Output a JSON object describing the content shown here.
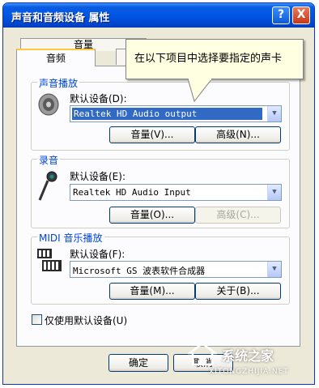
{
  "window": {
    "title": "声音和音频设备 属性",
    "help_glyph": "?",
    "close_glyph": "X"
  },
  "tabs": [
    {
      "label": "音量",
      "active": false
    },
    {
      "label": "音频",
      "active": true
    }
  ],
  "tooltip": "在以下项目中选择要指定的声卡",
  "sections": {
    "playback": {
      "title": "声音播放",
      "icon": "speaker-icon",
      "device_label": "默认设备(D):",
      "device_value": "Realtek HD Audio output",
      "volume_button": "音量(V)...",
      "advanced_button": "高级(N)..."
    },
    "recording": {
      "title": "录音",
      "icon": "microphone-icon",
      "device_label": "默认设备(E):",
      "device_value": "Realtek HD Audio Input",
      "volume_button": "音量(O)...",
      "advanced_button": "高级(C)..."
    },
    "midi": {
      "title": "MIDI 音乐播放",
      "icon": "midi-keyboard-icon",
      "device_label": "默认设备(F):",
      "device_value": "Microsoft GS 波表软件合成器",
      "volume_button": "音量(M)...",
      "about_button": "关于(B)..."
    }
  },
  "checkbox": {
    "label": "仅使用默认设备(U)",
    "checked": false
  },
  "footer": {
    "ok": "确定",
    "cancel": "取消"
  },
  "watermark": {
    "text": "系统之家",
    "url": "XITONGZHIJIA.NET"
  },
  "colors": {
    "titlebar": "#0055e5",
    "group_title": "#0046d5",
    "selection": "#316ac5",
    "tooltip_bg": "#ffffe1"
  }
}
